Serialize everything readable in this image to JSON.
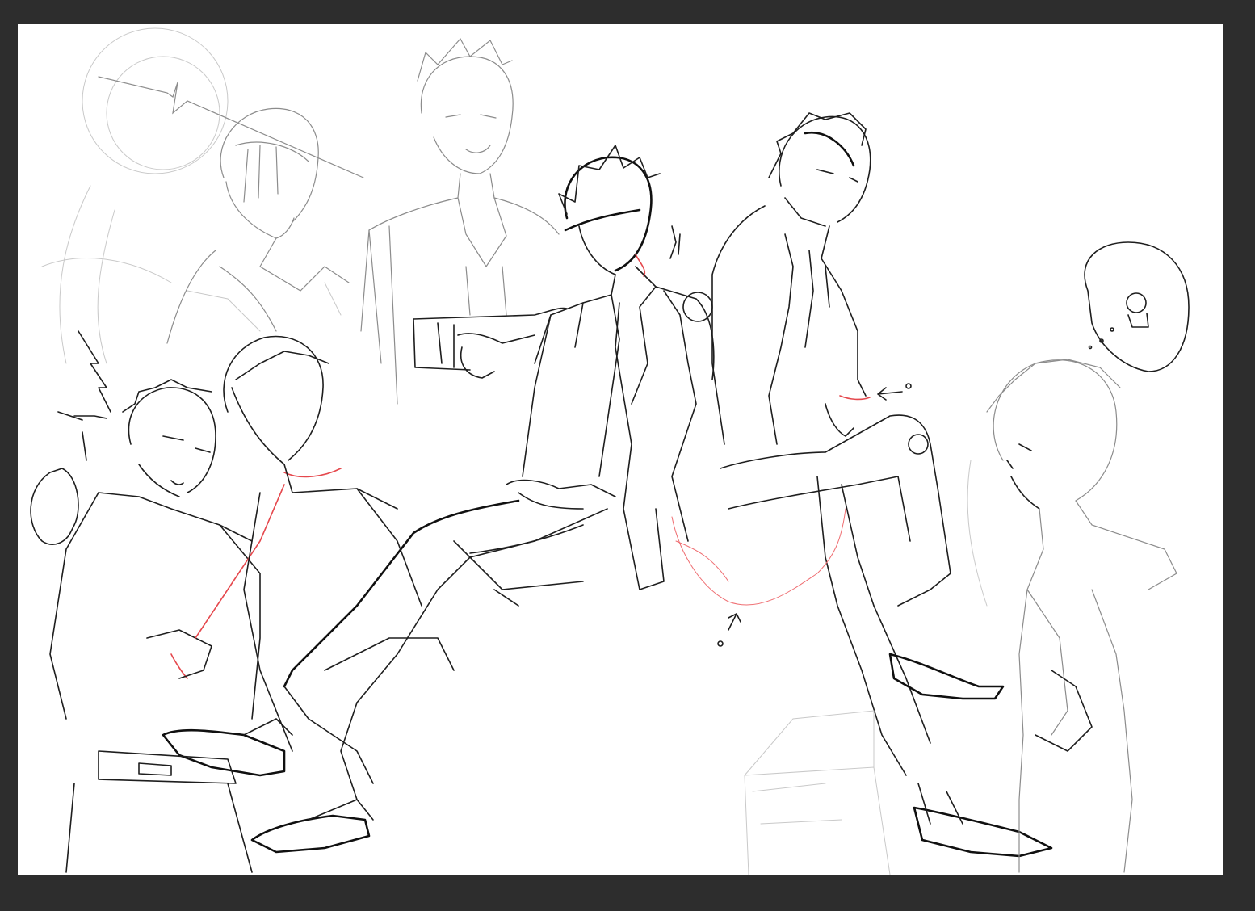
{
  "app": {
    "workspace_color": "#2d2d2d",
    "canvas_color": "#ffffff"
  },
  "artwork": {
    "ink_color": "#1e1e1e",
    "accent_color": "#e5484d",
    "rough_color": "#c9c9c9"
  }
}
